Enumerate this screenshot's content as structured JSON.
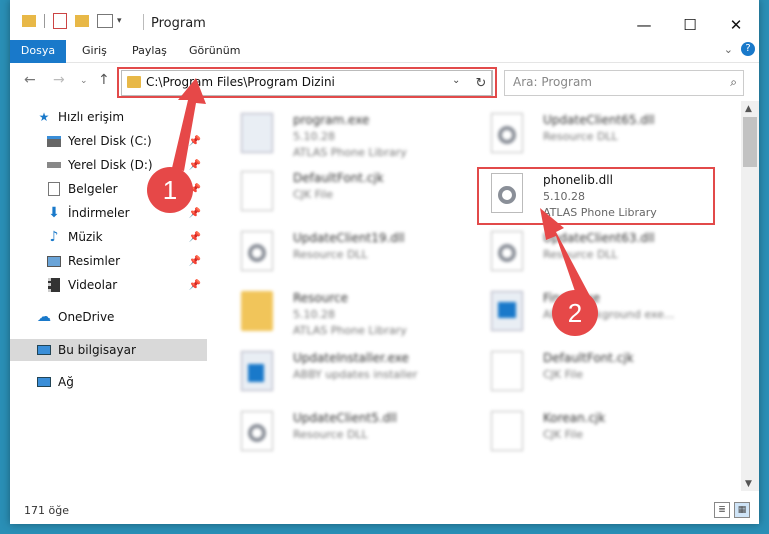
{
  "window": {
    "title": "Program"
  },
  "ribbon": {
    "tabs": [
      "Dosya",
      "Giriş",
      "Paylaş",
      "Görünüm"
    ]
  },
  "address": {
    "path": "C:\\Program Files\\Program Dizini"
  },
  "search": {
    "placeholder": "Ara: Program"
  },
  "nav": {
    "quick_access": "Hızlı erişim",
    "items": [
      {
        "label": "Yerel Disk (C:)",
        "icon": "drive-icon"
      },
      {
        "label": "Yerel Disk (D:)",
        "icon": "drive-icon"
      },
      {
        "label": "Belgeler",
        "icon": "documents-icon"
      },
      {
        "label": "İndirmeler",
        "icon": "downloads-icon"
      },
      {
        "label": "Müzik",
        "icon": "music-icon"
      },
      {
        "label": "Resimler",
        "icon": "pictures-icon"
      },
      {
        "label": "Videolar",
        "icon": "videos-icon"
      }
    ],
    "onedrive": "OneDrive",
    "this_pc": "Bu bilgisayar",
    "network": "Ağ"
  },
  "files": {
    "left": [
      {
        "name": "program.exe",
        "line2": "5.10.28",
        "line3": "ATLAS Phone Library",
        "type": "exe"
      },
      {
        "name": "DefaultFont.cjk",
        "line2": "CJK File",
        "line3": "",
        "type": "doc"
      },
      {
        "name": "UpdateClient19.dll",
        "line2": "Resource DLL",
        "line3": "",
        "type": "dll"
      },
      {
        "name": "Resource",
        "line2": "5.10.28",
        "line3": "ATLAS Phone Library",
        "type": "folder"
      },
      {
        "name": "UpdateInstaller.exe",
        "line2": "ABBY updates installer",
        "line3": "",
        "type": "exe"
      },
      {
        "name": "UpdateClient5.dll",
        "line2": "Resource DLL",
        "line3": "",
        "type": "dll"
      }
    ],
    "right": [
      {
        "name": "UpdateClient65.dll",
        "line2": "Resource DLL",
        "line3": "",
        "type": "dll"
      },
      {
        "name": "UpdateClient63.dll",
        "line2": "Resource DLL",
        "line3": "",
        "type": "dll"
      },
      {
        "name": "Fine...exe",
        "line2": "ABBY Background exe...",
        "line3": "",
        "type": "exe"
      },
      {
        "name": "DefaultFont.cjk",
        "line2": "CJK File",
        "line3": "",
        "type": "doc"
      },
      {
        "name": "Korean.cjk",
        "line2": "CJK File",
        "line3": "",
        "type": "doc"
      }
    ],
    "highlighted": {
      "name": "phonelib.dll",
      "line2": "5.10.28",
      "line3": "ATLAS Phone Library"
    }
  },
  "status": {
    "count": "171 öğe"
  },
  "annotations": {
    "step1": "1",
    "step2": "2",
    "color": "#e64848"
  }
}
